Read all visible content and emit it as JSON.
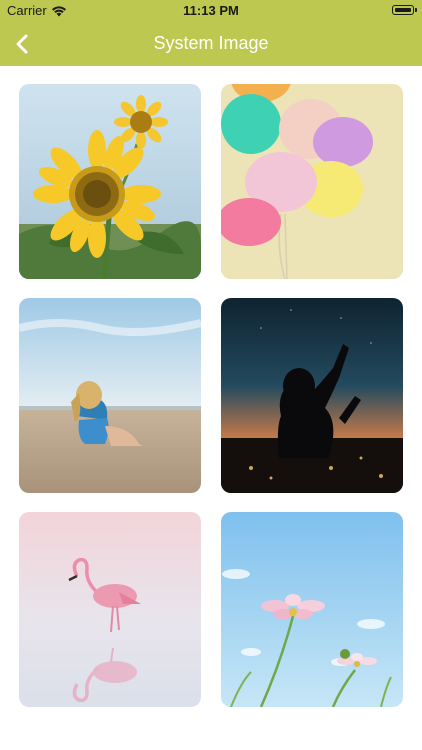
{
  "status_bar": {
    "carrier": "Carrier",
    "time": "11:13 PM",
    "icons": [
      "wifi-icon",
      "battery-icon"
    ]
  },
  "nav": {
    "title": "System Image",
    "back_icon": "chevron-left-icon",
    "background_color": "#bcc84f"
  },
  "images": [
    {
      "name": "sunflower",
      "subject": "sunflower"
    },
    {
      "name": "balloons",
      "subject": "balloons"
    },
    {
      "name": "girl-on-beach",
      "subject": "beach"
    },
    {
      "name": "silhouette-sunset",
      "subject": "silhouette"
    },
    {
      "name": "flamingo",
      "subject": "flamingo"
    },
    {
      "name": "cosmos-flowers",
      "subject": "flowers"
    }
  ]
}
